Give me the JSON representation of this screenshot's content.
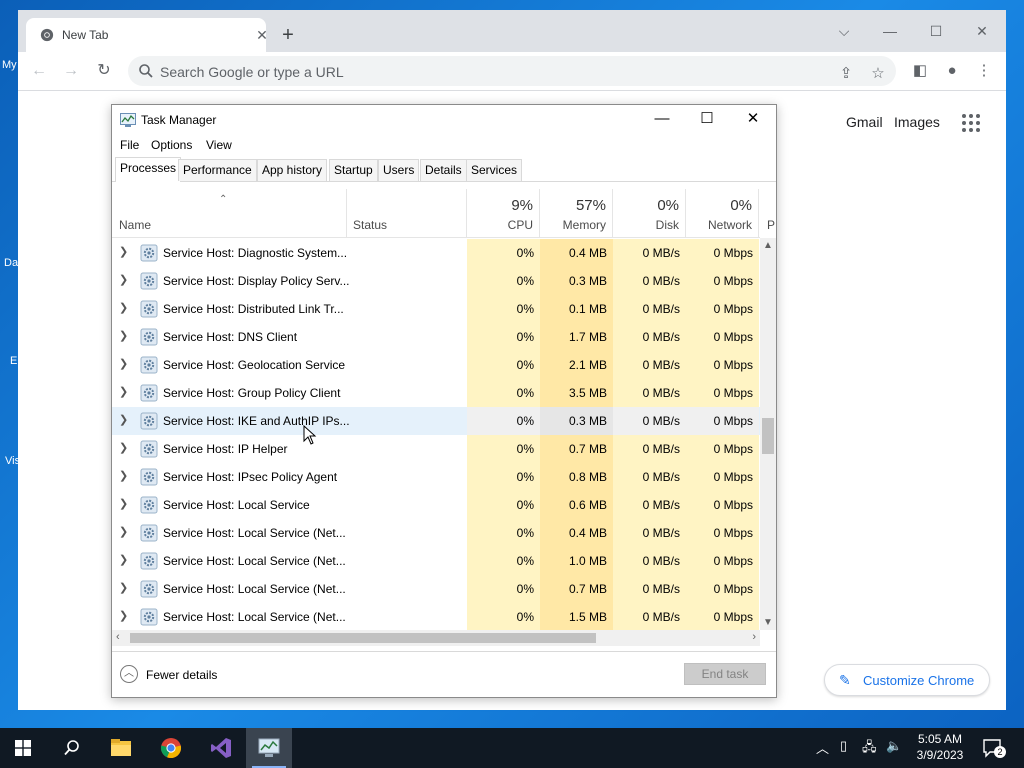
{
  "desktop": {
    "icon_labels": [
      "My",
      "Da",
      "E",
      "Vis"
    ]
  },
  "chrome": {
    "tab_title": "New Tab",
    "new_tab_symbol": "+",
    "omnibox_placeholder": "Search Google or type a URL",
    "links": {
      "gmail": "Gmail",
      "images": "Images"
    },
    "customize_label": "Customize Chrome"
  },
  "task_manager": {
    "title": "Task Manager",
    "menu": [
      "File",
      "Options",
      "View"
    ],
    "tabs": [
      "Processes",
      "Performance",
      "App history",
      "Startup",
      "Users",
      "Details",
      "Services"
    ],
    "active_tab": "Processes",
    "columns": {
      "name": "Name",
      "status": "Status",
      "cpu": {
        "pct": "9%",
        "label": "CPU"
      },
      "memory": {
        "pct": "57%",
        "label": "Memory"
      },
      "disk": {
        "pct": "0%",
        "label": "Disk"
      },
      "network": {
        "pct": "0%",
        "label": "Network"
      },
      "power_partial": "P"
    },
    "rows": [
      {
        "name": "Service Host: Diagnostic System...",
        "cpu": "0%",
        "memory": "0.4 MB",
        "disk": "0 MB/s",
        "network": "0 Mbps"
      },
      {
        "name": "Service Host: Display Policy Serv...",
        "cpu": "0%",
        "memory": "0.3 MB",
        "disk": "0 MB/s",
        "network": "0 Mbps"
      },
      {
        "name": "Service Host: Distributed Link Tr...",
        "cpu": "0%",
        "memory": "0.1 MB",
        "disk": "0 MB/s",
        "network": "0 Mbps"
      },
      {
        "name": "Service Host: DNS Client",
        "cpu": "0%",
        "memory": "1.7 MB",
        "disk": "0 MB/s",
        "network": "0 Mbps"
      },
      {
        "name": "Service Host: Geolocation Service",
        "cpu": "0%",
        "memory": "2.1 MB",
        "disk": "0 MB/s",
        "network": "0 Mbps"
      },
      {
        "name": "Service Host: Group Policy Client",
        "cpu": "0%",
        "memory": "3.5 MB",
        "disk": "0 MB/s",
        "network": "0 Mbps"
      },
      {
        "name": "Service Host: IKE and AuthIP IPs...",
        "cpu": "0%",
        "memory": "0.3 MB",
        "disk": "0 MB/s",
        "network": "0 Mbps"
      },
      {
        "name": "Service Host: IP Helper",
        "cpu": "0%",
        "memory": "0.7 MB",
        "disk": "0 MB/s",
        "network": "0 Mbps"
      },
      {
        "name": "Service Host: IPsec Policy Agent",
        "cpu": "0%",
        "memory": "0.8 MB",
        "disk": "0 MB/s",
        "network": "0 Mbps"
      },
      {
        "name": "Service Host: Local Service",
        "cpu": "0%",
        "memory": "0.6 MB",
        "disk": "0 MB/s",
        "network": "0 Mbps"
      },
      {
        "name": "Service Host: Local Service (Net...",
        "cpu": "0%",
        "memory": "0.4 MB",
        "disk": "0 MB/s",
        "network": "0 Mbps"
      },
      {
        "name": "Service Host: Local Service (Net...",
        "cpu": "0%",
        "memory": "1.0 MB",
        "disk": "0 MB/s",
        "network": "0 Mbps"
      },
      {
        "name": "Service Host: Local Service (Net...",
        "cpu": "0%",
        "memory": "0.7 MB",
        "disk": "0 MB/s",
        "network": "0 Mbps"
      },
      {
        "name": "Service Host: Local Service (Net...",
        "cpu": "0%",
        "memory": "1.5 MB",
        "disk": "0 MB/s",
        "network": "0 Mbps"
      }
    ],
    "fewer_details": "Fewer details",
    "end_task": "End task"
  },
  "taskbar": {
    "time": "5:05 AM",
    "date": "3/9/2023",
    "notification_count": "2"
  },
  "colors": {
    "accent_blue": "#1a73e8",
    "heat_light": "#fff4c4",
    "heat_memory": "#ffe8a6"
  }
}
